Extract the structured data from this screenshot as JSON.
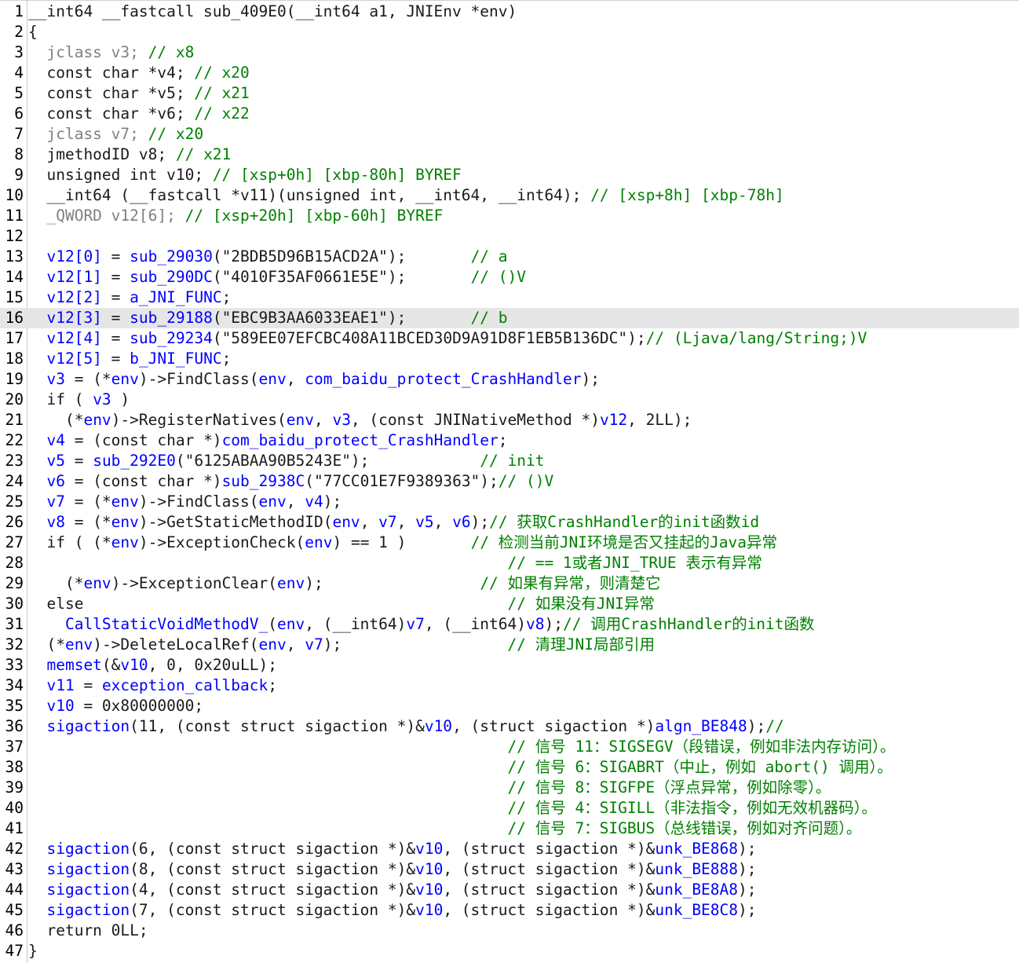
{
  "colors": {
    "keyword": "#1a1a1a",
    "gray": "#808080",
    "comment": "#008000",
    "identifier_blue": "#0000ff",
    "highlight_line": "#e6e6e6"
  },
  "highlighted_line": 16,
  "lines": [
    [
      [
        "k",
        "__int64 __fastcall sub_409E0(__int64 a1, JNIEnv *env)"
      ]
    ],
    [
      [
        "k",
        "{"
      ]
    ],
    [
      [
        "g",
        "  jclass v3; "
      ],
      [
        "c",
        "// x8"
      ]
    ],
    [
      [
        "k",
        "  const char *v4; "
      ],
      [
        "c",
        "// x20"
      ]
    ],
    [
      [
        "k",
        "  const char *v5; "
      ],
      [
        "c",
        "// x21"
      ]
    ],
    [
      [
        "k",
        "  const char *v6; "
      ],
      [
        "c",
        "// x22"
      ]
    ],
    [
      [
        "g",
        "  jclass v7; "
      ],
      [
        "c",
        "// x20"
      ]
    ],
    [
      [
        "k",
        "  jmethodID v8; "
      ],
      [
        "c",
        "// x21"
      ]
    ],
    [
      [
        "k",
        "  unsigned int v10; "
      ],
      [
        "c",
        "// [xsp+0h] [xbp-80h] BYREF"
      ]
    ],
    [
      [
        "k",
        "  __int64 (__fastcall *v11)(unsigned int, __int64, __int64); "
      ],
      [
        "c",
        "// [xsp+8h] [xbp-78h]"
      ]
    ],
    [
      [
        "g",
        "  _QWORD v12[6]; "
      ],
      [
        "c",
        "// [xsp+20h] [xbp-60h] BYREF"
      ]
    ],
    [
      [
        "k",
        ""
      ]
    ],
    [
      [
        "b",
        "  v12[0]"
      ],
      [
        "k",
        " = "
      ],
      [
        "f",
        "sub_29030"
      ],
      [
        "k",
        "(\"2BDB5D96B15ACD2A\");       "
      ],
      [
        "cn",
        "// a"
      ]
    ],
    [
      [
        "b",
        "  v12[1]"
      ],
      [
        "k",
        " = "
      ],
      [
        "f",
        "sub_290DC"
      ],
      [
        "k",
        "(\"4010F35AF0661E5E\");       "
      ],
      [
        "cn",
        "// ()V"
      ]
    ],
    [
      [
        "b",
        "  v12[2]"
      ],
      [
        "k",
        " = "
      ],
      [
        "f",
        "a_JNI_FUNC"
      ],
      [
        "k",
        ";"
      ]
    ],
    [
      [
        "b",
        "  v12[3]"
      ],
      [
        "k",
        " = "
      ],
      [
        "f",
        "sub_29188"
      ],
      [
        "k",
        "(\"EBC9B3AA6033EAE1\");       "
      ],
      [
        "cn",
        "// b"
      ]
    ],
    [
      [
        "b",
        "  v12[4]"
      ],
      [
        "k",
        " = "
      ],
      [
        "f",
        "sub_29234"
      ],
      [
        "k",
        "(\"589EE07EFCBC408A11BCED30D9A91D8F1EB5B136DC\");"
      ],
      [
        "cn",
        "// (Ljava/lang/String;)V"
      ]
    ],
    [
      [
        "b",
        "  v12[5]"
      ],
      [
        "k",
        " = "
      ],
      [
        "f",
        "b_JNI_FUNC"
      ],
      [
        "k",
        ";"
      ]
    ],
    [
      [
        "b",
        "  v3"
      ],
      [
        "k",
        " = (*"
      ],
      [
        "b",
        "env"
      ],
      [
        "k",
        ")->FindClass("
      ],
      [
        "b",
        "env"
      ],
      [
        "k",
        ", "
      ],
      [
        "f",
        "com_baidu_protect_CrashHandler"
      ],
      [
        "k",
        ");"
      ]
    ],
    [
      [
        "k",
        "  if ( "
      ],
      [
        "b",
        "v3"
      ],
      [
        "k",
        " )"
      ]
    ],
    [
      [
        "k",
        "    (*"
      ],
      [
        "b",
        "env"
      ],
      [
        "k",
        ")->RegisterNatives("
      ],
      [
        "b",
        "env"
      ],
      [
        "k",
        ", "
      ],
      [
        "b",
        "v3"
      ],
      [
        "k",
        ", (const JNINativeMethod *)"
      ],
      [
        "b",
        "v12"
      ],
      [
        "k",
        ", 2LL);"
      ]
    ],
    [
      [
        "b",
        "  v4"
      ],
      [
        "k",
        " = (const char *)"
      ],
      [
        "f",
        "com_baidu_protect_CrashHandler"
      ],
      [
        "k",
        ";"
      ]
    ],
    [
      [
        "b",
        "  v5"
      ],
      [
        "k",
        " = "
      ],
      [
        "f",
        "sub_292E0"
      ],
      [
        "k",
        "(\"6125ABAA90B5243E\");            "
      ],
      [
        "cn",
        "// init"
      ]
    ],
    [
      [
        "b",
        "  v6"
      ],
      [
        "k",
        " = (const char *)"
      ],
      [
        "f",
        "sub_2938C"
      ],
      [
        "k",
        "(\"77CC01E7F9389363\");"
      ],
      [
        "cn",
        "// ()V"
      ]
    ],
    [
      [
        "b",
        "  v7"
      ],
      [
        "k",
        " = (*"
      ],
      [
        "b",
        "env"
      ],
      [
        "k",
        ")->FindClass("
      ],
      [
        "b",
        "env"
      ],
      [
        "k",
        ", "
      ],
      [
        "b",
        "v4"
      ],
      [
        "k",
        ");"
      ]
    ],
    [
      [
        "b",
        "  v8"
      ],
      [
        "k",
        " = (*"
      ],
      [
        "b",
        "env"
      ],
      [
        "k",
        ")->GetStaticMethodID("
      ],
      [
        "b",
        "env"
      ],
      [
        "k",
        ", "
      ],
      [
        "b",
        "v7"
      ],
      [
        "k",
        ", "
      ],
      [
        "b",
        "v5"
      ],
      [
        "k",
        ", "
      ],
      [
        "b",
        "v6"
      ],
      [
        "k",
        ");"
      ],
      [
        "cn",
        "// 获取CrashHandler的init函数id"
      ]
    ],
    [
      [
        "k",
        "  if ( (*"
      ],
      [
        "b",
        "env"
      ],
      [
        "k",
        ")->ExceptionCheck("
      ],
      [
        "b",
        "env"
      ],
      [
        "k",
        ") == 1 )       "
      ],
      [
        "cn",
        "// 检测当前JNI环境是否又挂起的Java异常"
      ]
    ],
    [
      [
        "k",
        "                                                    "
      ],
      [
        "cn",
        "// == 1或者JNI_TRUE 表示有异常"
      ]
    ],
    [
      [
        "k",
        "    (*"
      ],
      [
        "b",
        "env"
      ],
      [
        "k",
        ")->ExceptionClear("
      ],
      [
        "b",
        "env"
      ],
      [
        "k",
        ");                 "
      ],
      [
        "cn",
        "// 如果有异常，则清楚它"
      ]
    ],
    [
      [
        "k",
        "  else                                              "
      ],
      [
        "cn",
        "// 如果没有JNI异常"
      ]
    ],
    [
      [
        "f",
        "    CallStaticVoidMethodV_"
      ],
      [
        "k",
        "("
      ],
      [
        "b",
        "env"
      ],
      [
        "k",
        ", (__int64)"
      ],
      [
        "b",
        "v7"
      ],
      [
        "k",
        ", (__int64)"
      ],
      [
        "b",
        "v8"
      ],
      [
        "k",
        ");"
      ],
      [
        "cn",
        "// 调用CrashHandler的init函数"
      ]
    ],
    [
      [
        "k",
        "  (*"
      ],
      [
        "b",
        "env"
      ],
      [
        "k",
        ")->DeleteLocalRef("
      ],
      [
        "b",
        "env"
      ],
      [
        "k",
        ", "
      ],
      [
        "b",
        "v7"
      ],
      [
        "k",
        ");                  "
      ],
      [
        "cn",
        "// 清理JNI局部引用"
      ]
    ],
    [
      [
        "f",
        "  memset"
      ],
      [
        "k",
        "(&"
      ],
      [
        "b",
        "v10"
      ],
      [
        "k",
        ", 0, 0x20uLL);"
      ]
    ],
    [
      [
        "b",
        "  v11"
      ],
      [
        "k",
        " = "
      ],
      [
        "f",
        "exception_callback"
      ],
      [
        "k",
        ";"
      ]
    ],
    [
      [
        "b",
        "  v10"
      ],
      [
        "k",
        " = 0x80000000;"
      ]
    ],
    [
      [
        "f",
        "  sigaction"
      ],
      [
        "k",
        "(11, (const struct sigaction *)&"
      ],
      [
        "b",
        "v10"
      ],
      [
        "k",
        ", (struct sigaction *)"
      ],
      [
        "f",
        "algn_BE848"
      ],
      [
        "k",
        ");"
      ],
      [
        "cn",
        "//"
      ]
    ],
    [
      [
        "k",
        "                                                    "
      ],
      [
        "cn",
        "// 信号 11：SIGSEGV（段错误，例如非法内存访问）。"
      ]
    ],
    [
      [
        "k",
        "                                                    "
      ],
      [
        "cn",
        "// 信号 6：SIGABRT（中止，例如 abort() 调用）。"
      ]
    ],
    [
      [
        "k",
        "                                                    "
      ],
      [
        "cn",
        "// 信号 8：SIGFPE（浮点异常，例如除零）。"
      ]
    ],
    [
      [
        "k",
        "                                                    "
      ],
      [
        "cn",
        "// 信号 4：SIGILL（非法指令，例如无效机器码）。"
      ]
    ],
    [
      [
        "k",
        "                                                    "
      ],
      [
        "cn",
        "// 信号 7：SIGBUS（总线错误，例如对齐问题）。"
      ]
    ],
    [
      [
        "f",
        "  sigaction"
      ],
      [
        "k",
        "(6, (const struct sigaction *)&"
      ],
      [
        "b",
        "v10"
      ],
      [
        "k",
        ", (struct sigaction *)&"
      ],
      [
        "f",
        "unk_BE868"
      ],
      [
        "k",
        ");"
      ]
    ],
    [
      [
        "f",
        "  sigaction"
      ],
      [
        "k",
        "(8, (const struct sigaction *)&"
      ],
      [
        "b",
        "v10"
      ],
      [
        "k",
        ", (struct sigaction *)&"
      ],
      [
        "f",
        "unk_BE888"
      ],
      [
        "k",
        ");"
      ]
    ],
    [
      [
        "f",
        "  sigaction"
      ],
      [
        "k",
        "(4, (const struct sigaction *)&"
      ],
      [
        "b",
        "v10"
      ],
      [
        "k",
        ", (struct sigaction *)&"
      ],
      [
        "f",
        "unk_BE8A8"
      ],
      [
        "k",
        ");"
      ]
    ],
    [
      [
        "f",
        "  sigaction"
      ],
      [
        "k",
        "(7, (const struct sigaction *)&"
      ],
      [
        "b",
        "v10"
      ],
      [
        "k",
        ", (struct sigaction *)&"
      ],
      [
        "f",
        "unk_BE8C8"
      ],
      [
        "k",
        ");"
      ]
    ],
    [
      [
        "k",
        "  return 0LL;"
      ]
    ],
    [
      [
        "k",
        "}"
      ]
    ]
  ]
}
